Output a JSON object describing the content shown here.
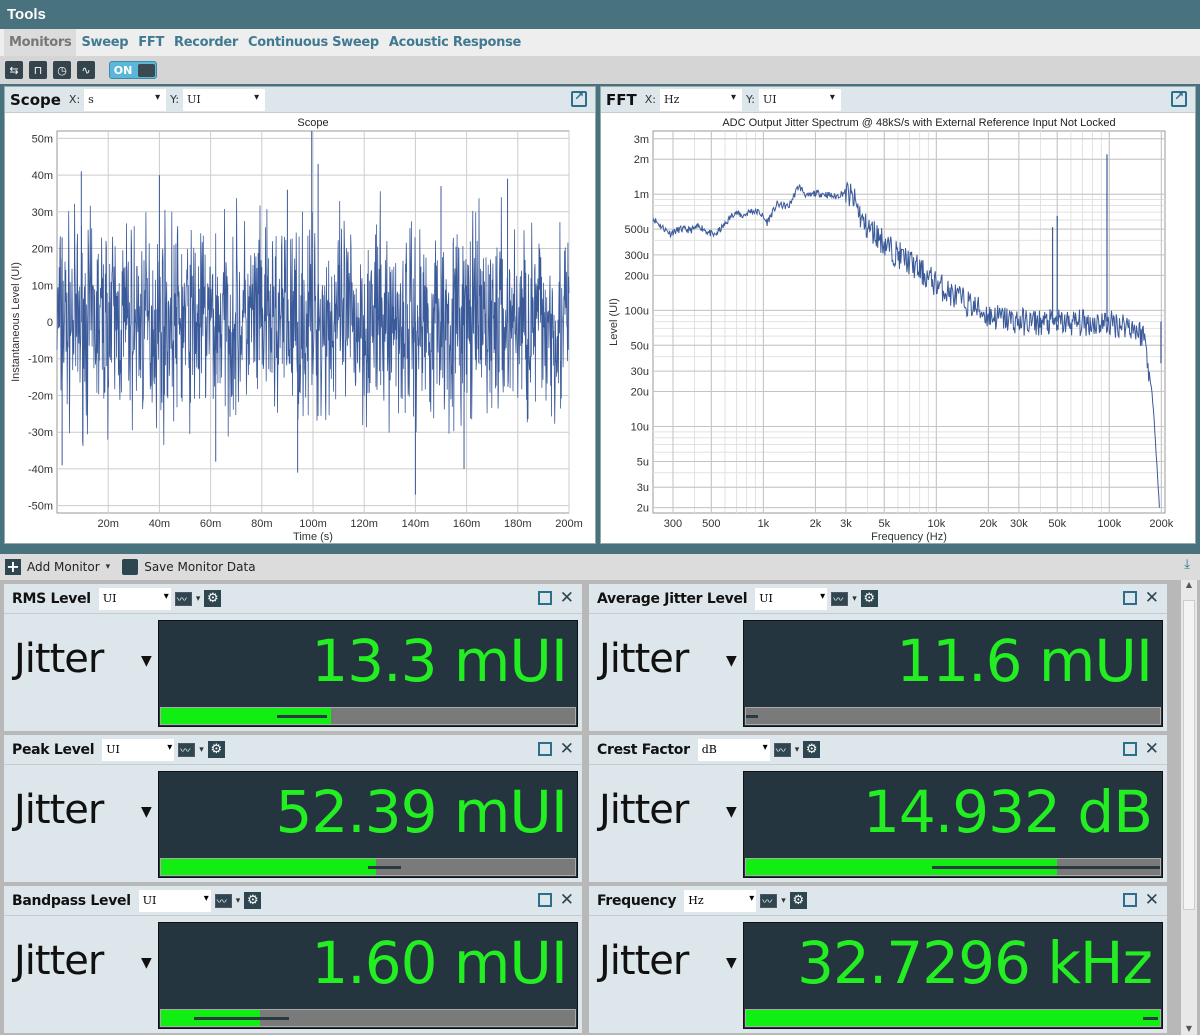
{
  "window": {
    "title": "Tools"
  },
  "tabs": [
    {
      "label": "Monitors",
      "active": true
    },
    {
      "label": "Sweep"
    },
    {
      "label": "FFT"
    },
    {
      "label": "Recorder"
    },
    {
      "label": "Continuous Sweep"
    },
    {
      "label": "Acoustic Response"
    }
  ],
  "toolbar": {
    "toggle_label": "ON",
    "toggle_on": true
  },
  "scope": {
    "panel_title": "Scope",
    "x_label": "X:",
    "x_unit": "s",
    "y_label": "Y:",
    "y_unit": "UI"
  },
  "fft": {
    "panel_title": "FFT",
    "x_label": "X:",
    "x_unit": "Hz",
    "y_label": "Y:",
    "y_unit": "UI"
  },
  "chart_data": [
    {
      "type": "line",
      "title": "Scope",
      "xlabel": "Time (s)",
      "ylabel": "Instantaneous Level (UI)",
      "xlim": [
        0,
        0.2
      ],
      "ylim": [
        -0.052,
        0.052
      ],
      "xticks": [
        {
          "v": 0.02,
          "label": "20m"
        },
        {
          "v": 0.04,
          "label": "40m"
        },
        {
          "v": 0.06,
          "label": "60m"
        },
        {
          "v": 0.08,
          "label": "80m"
        },
        {
          "v": 0.1,
          "label": "100m"
        },
        {
          "v": 0.12,
          "label": "120m"
        },
        {
          "v": 0.14,
          "label": "140m"
        },
        {
          "v": 0.16,
          "label": "160m"
        },
        {
          "v": 0.18,
          "label": "180m"
        },
        {
          "v": 0.2,
          "label": "200m"
        }
      ],
      "yticks": [
        {
          "v": 0.05,
          "label": "50m"
        },
        {
          "v": 0.04,
          "label": "40m"
        },
        {
          "v": 0.03,
          "label": "30m"
        },
        {
          "v": 0.02,
          "label": "20m"
        },
        {
          "v": 0.01,
          "label": "10m"
        },
        {
          "v": 0,
          "label": "0"
        },
        {
          "v": -0.01,
          "label": "-10m"
        },
        {
          "v": -0.02,
          "label": "-20m"
        },
        {
          "v": -0.03,
          "label": "-30m"
        },
        {
          "v": -0.04,
          "label": "-40m"
        },
        {
          "v": -0.05,
          "label": "-50m"
        }
      ],
      "series_color": "#3b5a9a",
      "description": "dense random jitter waveform, approx +/-25m typical, peaks to +52m near 0.1s and -47m near 0.14s",
      "peaks": [
        [
          0.002,
          0.023
        ],
        [
          0.0095,
          0.041
        ],
        [
          0.0995,
          0.052
        ],
        [
          0.102,
          0.043
        ],
        [
          0.04,
          0.04
        ],
        [
          0.09,
          0.036
        ],
        [
          0.15,
          0.037
        ],
        [
          0.176,
          0.039
        ],
        [
          0.14,
          -0.047
        ],
        [
          0.094,
          -0.041
        ],
        [
          0.159,
          -0.04
        ],
        [
          0.002,
          -0.039
        ],
        [
          0.062,
          -0.038
        ]
      ]
    },
    {
      "type": "line",
      "title": "ADC Output Jitter Spectrum @ 48kS/s with External Reference Input Not Locked",
      "xlabel": "Frequency (Hz)",
      "ylabel": "Level (UI)",
      "xscale": "log",
      "yscale": "log",
      "xlim": [
        230,
        210000
      ],
      "ylim": [
        1.8e-06,
        0.0035
      ],
      "xticks": [
        {
          "v": 300,
          "label": "300"
        },
        {
          "v": 500,
          "label": "500"
        },
        {
          "v": 1000,
          "label": "1k"
        },
        {
          "v": 2000,
          "label": "2k"
        },
        {
          "v": 3000,
          "label": "3k"
        },
        {
          "v": 5000,
          "label": "5k"
        },
        {
          "v": 10000,
          "label": "10k"
        },
        {
          "v": 20000,
          "label": "20k"
        },
        {
          "v": 30000,
          "label": "30k"
        },
        {
          "v": 50000,
          "label": "50k"
        },
        {
          "v": 100000,
          "label": "100k"
        },
        {
          "v": 200000,
          "label": "200k"
        }
      ],
      "yticks": [
        {
          "v": 0.003,
          "label": "3m"
        },
        {
          "v": 0.002,
          "label": "2m"
        },
        {
          "v": 0.001,
          "label": "1m"
        },
        {
          "v": 0.0005,
          "label": "500u"
        },
        {
          "v": 0.0003,
          "label": "300u"
        },
        {
          "v": 0.0002,
          "label": "200u"
        },
        {
          "v": 0.0001,
          "label": "100u"
        },
        {
          "v": 5e-05,
          "label": "50u"
        },
        {
          "v": 3e-05,
          "label": "30u"
        },
        {
          "v": 2e-05,
          "label": "20u"
        },
        {
          "v": 1e-05,
          "label": "10u"
        },
        {
          "v": 5e-06,
          "label": "5u"
        },
        {
          "v": 3e-06,
          "label": "3u"
        },
        {
          "v": 2e-06,
          "label": "2u"
        }
      ],
      "series_color": "#3b5a9a",
      "points": [
        [
          230,
          0.00062
        ],
        [
          260,
          0.00052
        ],
        [
          290,
          0.00046
        ],
        [
          330,
          0.0005
        ],
        [
          380,
          0.00049
        ],
        [
          430,
          0.00053
        ],
        [
          480,
          0.00047
        ],
        [
          520,
          0.00044
        ],
        [
          600,
          0.00055
        ],
        [
          680,
          0.0007
        ],
        [
          760,
          0.00065
        ],
        [
          850,
          0.00072
        ],
        [
          950,
          0.0007
        ],
        [
          1050,
          0.00057
        ],
        [
          1200,
          0.00082
        ],
        [
          1400,
          0.00078
        ],
        [
          1600,
          0.00118
        ],
        [
          1800,
          0.00095
        ],
        [
          2000,
          0.00102
        ],
        [
          2300,
          0.001
        ],
        [
          2600,
          0.00095
        ],
        [
          3000,
          0.00105
        ],
        [
          3400,
          0.00085
        ],
        [
          3800,
          0.00055
        ],
        [
          4500,
          0.00045
        ],
        [
          5500,
          0.00033
        ],
        [
          7000,
          0.00026
        ],
        [
          9000,
          0.00019
        ],
        [
          12000,
          0.00014
        ],
        [
          16000,
          0.00011
        ],
        [
          20000,
          9e-05
        ],
        [
          30000,
          8e-05
        ],
        [
          45000,
          7.8e-05
        ],
        [
          60000,
          7.8e-05
        ],
        [
          90000,
          7.8e-05
        ],
        [
          130000,
          7.5e-05
        ],
        [
          160000,
          6e-05
        ],
        [
          180000,
          1.5e-05
        ],
        [
          195000,
          2e-06
        ]
      ],
      "spikes": [
        [
          47000,
          0.00052
        ],
        [
          50000,
          0.00065
        ],
        [
          97000,
          0.0022
        ],
        [
          199000,
          3.5e-05
        ]
      ]
    }
  ],
  "monitor_toolbar": {
    "add_label": "Add Monitor",
    "save_label": "Save Monitor Data"
  },
  "monitors": [
    {
      "name": "RMS Level",
      "unit": "UI",
      "signal": "Jitter",
      "value": "13.3 mUI",
      "bar_fill": 0.41,
      "marker": [
        0.28,
        0.4
      ]
    },
    {
      "name": "Average Jitter Level",
      "unit": "UI",
      "signal": "Jitter",
      "value": "11.6 mUI",
      "bar_fill": 0.0,
      "marker": [
        0.0,
        0.03
      ]
    },
    {
      "name": "Peak Level",
      "unit": "UI",
      "signal": "Jitter",
      "value": "52.39 mUI",
      "bar_fill": 0.52,
      "marker": [
        0.5,
        0.58
      ]
    },
    {
      "name": "Crest Factor",
      "unit": "dB",
      "signal": "Jitter",
      "value": "14.932 dB",
      "bar_fill": 0.75,
      "marker": [
        0.45,
        1.0
      ]
    },
    {
      "name": "Bandpass Level",
      "unit": "UI",
      "signal": "Jitter",
      "value": "1.60 mUI",
      "bar_fill": 0.24,
      "marker": [
        0.08,
        0.31
      ]
    },
    {
      "name": "Frequency",
      "unit": "Hz",
      "signal": "Jitter",
      "value": "32.7296 kHz",
      "bar_fill": 1.0,
      "marker": [
        0.96,
        0.995
      ]
    }
  ]
}
